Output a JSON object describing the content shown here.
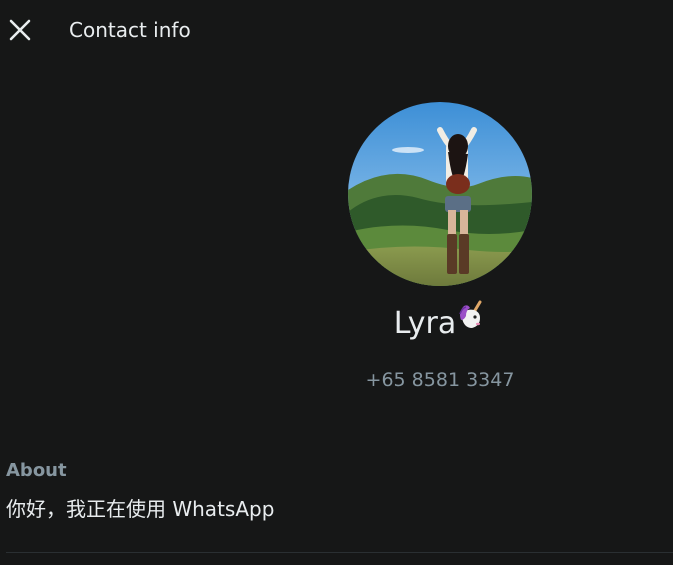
{
  "header": {
    "close_icon": "close-icon",
    "title": "Contact info"
  },
  "contact": {
    "name": "Lyra",
    "name_emoji": "unicorn-emoji",
    "phone": "+65 8581 3347"
  },
  "about": {
    "heading": "About",
    "text": "你好，我正在使用 WhatsApp"
  },
  "colors": {
    "background": "#161717",
    "primary_text": "#e9edef",
    "secondary_text": "#8696a0",
    "divider": "#2a2f32"
  }
}
